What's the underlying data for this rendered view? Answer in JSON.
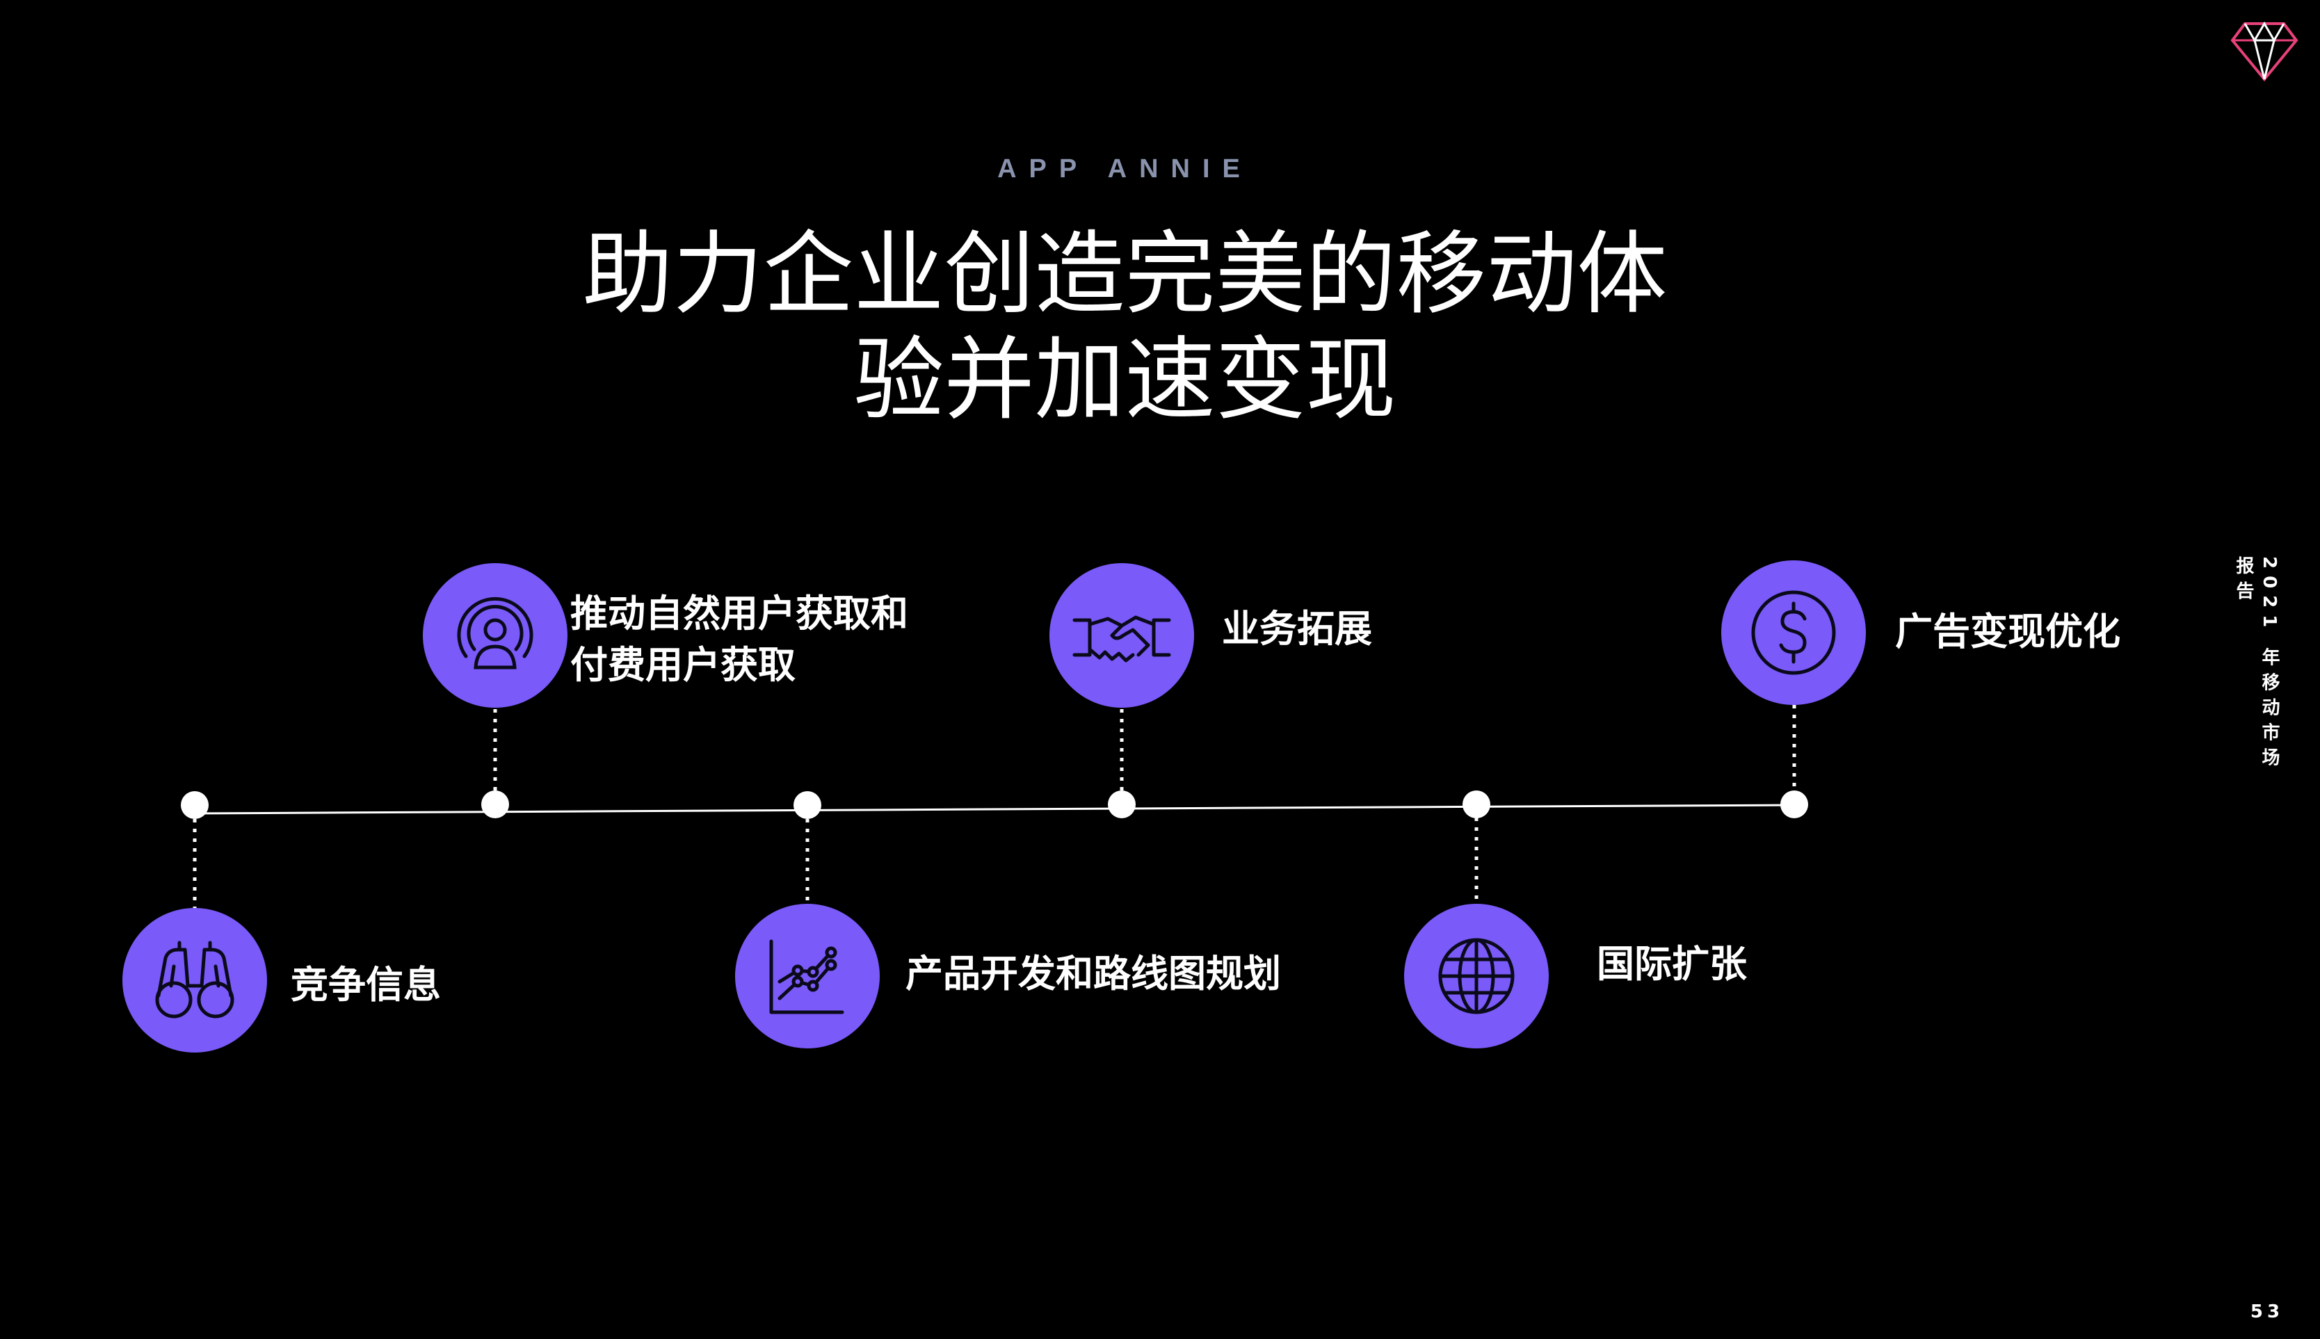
{
  "brand": "APP ANNIE",
  "title": {
    "line1": "助力企业创造完美的移动体",
    "line2": "验并加速变现"
  },
  "side_caption": "2021 年移动市场报告",
  "page_number": "53",
  "colors": {
    "background": "#000000",
    "accent_circle": "#7a5af8",
    "brand_text": "#8a93ad",
    "logo_pink": "#e8417a"
  },
  "milestones": [
    {
      "id": "competitive-intel",
      "label": "竞争信息",
      "icon": "binoculars-icon"
    },
    {
      "id": "user-acquisition",
      "label_line1": "推动自然用户获取和",
      "label_line2": "付费用户获取",
      "icon": "target-user-icon"
    },
    {
      "id": "product-roadmap",
      "label": "产品开发和路线图规划",
      "icon": "line-chart-icon"
    },
    {
      "id": "business-expansion",
      "label": "业务拓展",
      "icon": "handshake-icon"
    },
    {
      "id": "international",
      "label": "国际扩张",
      "icon": "globe-icon"
    },
    {
      "id": "ad-monetization",
      "label": "广告变现优化",
      "icon": "dollar-coin-icon"
    }
  ]
}
